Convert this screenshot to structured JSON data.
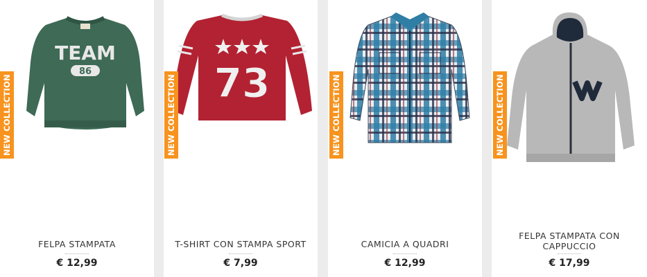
{
  "ribbon_label": "NEW COLLECTION",
  "products": [
    {
      "name": "FELPA STAMPATA",
      "price": "€ 12,99",
      "print_word": "TEAM",
      "print_number": "86"
    },
    {
      "name": "T-SHIRT CON STAMPA SPORT",
      "price": "€ 7,99",
      "print_number": "73"
    },
    {
      "name": "CAMICIA A QUADRI",
      "price": "€ 12,99"
    },
    {
      "name_line1": "FELPA STAMPATA CON",
      "name_line2": "CAPPUCCIO",
      "price": "€ 17,99"
    }
  ],
  "colors": {
    "ribbon": "#f7931e",
    "background": "#ececec",
    "card": "#ffffff",
    "green_sweater": "#3e6a56",
    "red_tshirt": "#b32232",
    "plaid_blue": "#2f7ea6",
    "grey_hoodie": "#b8b8b8"
  }
}
